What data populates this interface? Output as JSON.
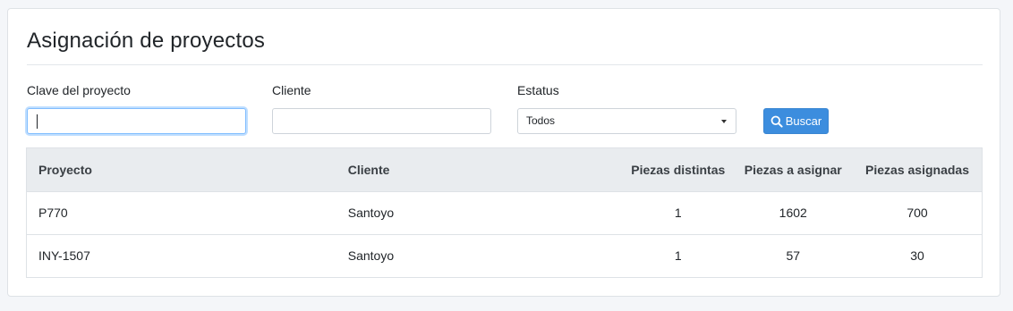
{
  "card": {
    "title": "Asignación de proyectos"
  },
  "filters": {
    "clave_label": "Clave del proyecto",
    "clave_value": "",
    "cliente_label": "Cliente",
    "cliente_value": "",
    "estatus_label": "Estatus",
    "estatus_selected": "Todos",
    "search_button_label": "Buscar",
    "search_button_icon": "search-icon"
  },
  "table": {
    "headers": [
      "Proyecto",
      "Cliente",
      "Piezas distintas",
      "Piezas a asignar",
      "Piezas asignadas"
    ],
    "rows": [
      [
        "P770",
        "Santoyo",
        "1",
        "1602",
        "700"
      ],
      [
        "INY-1507",
        "Santoyo",
        "1",
        "57",
        "30"
      ]
    ]
  },
  "colors": {
    "accent": "#3c8dde",
    "header_bg": "#e9ecef",
    "page_bg": "#f4f6f9"
  }
}
